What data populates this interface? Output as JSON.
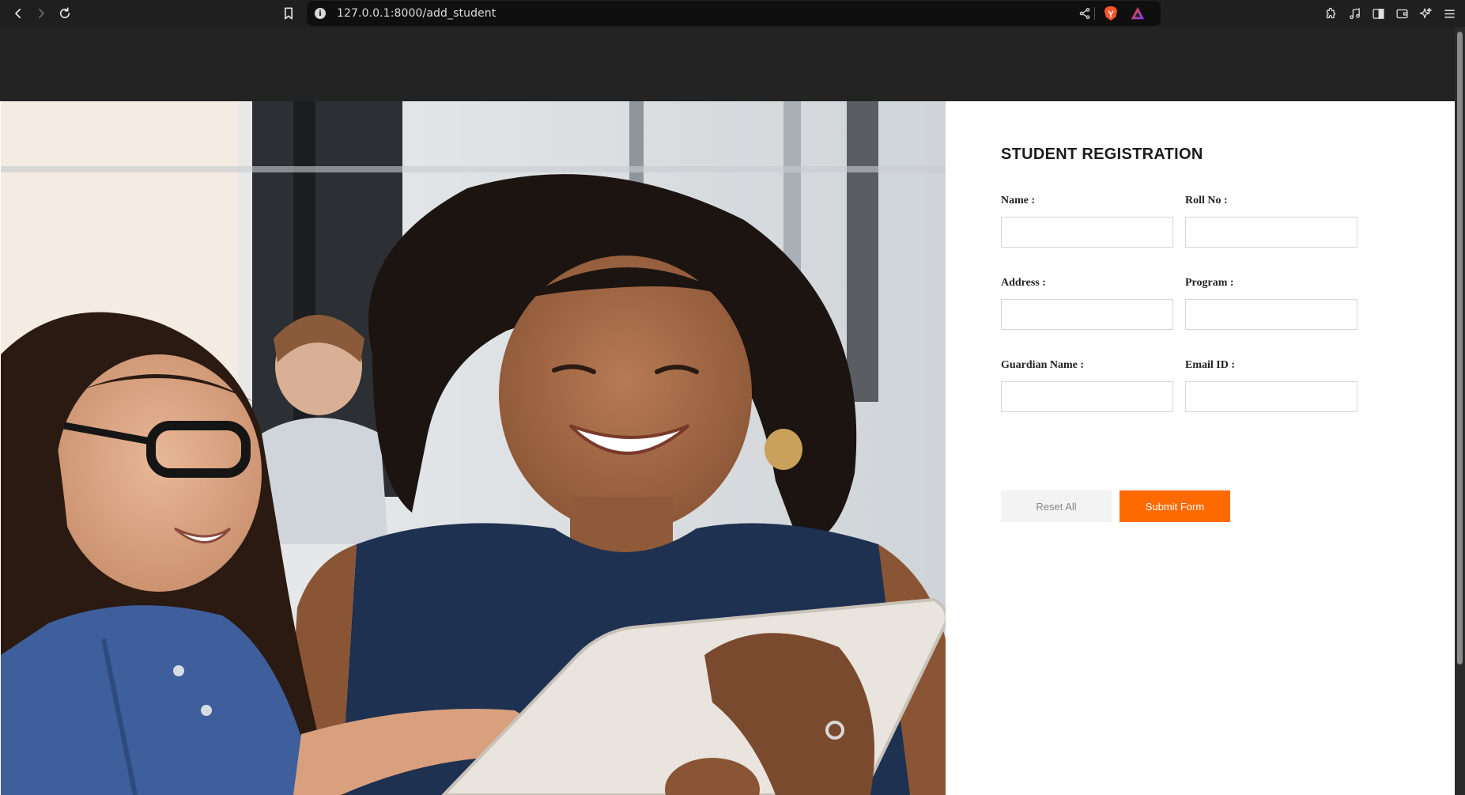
{
  "browser": {
    "url": "127.0.0.1:8000/add_student",
    "info_glyph": "i",
    "icons": [
      "back-icon",
      "forward-icon",
      "reload-icon",
      "bookmark-icon",
      "site-info-icon",
      "share-icon",
      "brave-shields-icon",
      "brave-rewards-icon",
      "extensions-icon",
      "media-icon",
      "sidebar-icon",
      "wallet-icon",
      "leo-ai-icon",
      "menu-icon"
    ]
  },
  "hero": {
    "image": "photo of a smiling teacher and a student with glasses looking at a tablet in a classroom"
  },
  "form": {
    "title": "STUDENT REGISTRATION",
    "fields": {
      "name": {
        "label": "Name :",
        "value": ""
      },
      "roll_no": {
        "label": "Roll No :",
        "value": ""
      },
      "address": {
        "label": "Address :",
        "value": ""
      },
      "program": {
        "label": "Program :",
        "value": ""
      },
      "guardian_name": {
        "label": "Guardian Name :",
        "value": ""
      },
      "email_id": {
        "label": "Email ID :",
        "value": ""
      }
    },
    "reset_label": "Reset All",
    "submit_label": "Submit Form"
  },
  "colors": {
    "header_band": "#232323",
    "submit_button": "#ff6a00",
    "reset_button": "#f3f3f3",
    "browser_chrome": "#1f1f1f"
  }
}
